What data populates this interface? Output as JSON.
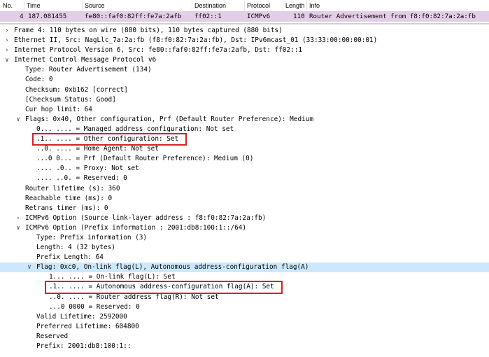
{
  "packet_list": {
    "columns": [
      "No.",
      "Time",
      "Source",
      "Destination",
      "Protocol",
      "Length",
      "Info"
    ],
    "selected_row": {
      "no": "4",
      "time": "187.081455",
      "source": "fe80::faf0:82ff:fe7a:2afb",
      "destination": "ff02::1",
      "protocol": "ICMPv6",
      "length": "110",
      "info": "Router Advertisement from f8:f0:82:7a:2a:fb"
    }
  },
  "details": [
    {
      "text": "Frame 4: 110 bytes on wire (880 bits), 110 bytes captured (880 bits)",
      "arrow": "collapsed",
      "indent": 0
    },
    {
      "text": "Ethernet II, Src: NagLlc_7a:2a:fb (f8:f0:82:7a:2a:fb), Dst: IPv6mcast_01 (33:33:00:00:00:01)",
      "arrow": "collapsed",
      "indent": 0
    },
    {
      "text": "Internet Protocol Version 6, Src: fe80::faf0:82ff:fe7a:2afb, Dst: ff02::1",
      "arrow": "collapsed",
      "indent": 0
    },
    {
      "text": "Internet Control Message Protocol v6",
      "arrow": "expanded",
      "indent": 0
    },
    {
      "text": "Type: Router Advertisement (134)",
      "arrow": "none",
      "indent": 1
    },
    {
      "text": "Code: 0",
      "arrow": "none",
      "indent": 1
    },
    {
      "text": "Checksum: 0xb162 [correct]",
      "arrow": "none",
      "indent": 1
    },
    {
      "text": "[Checksum Status: Good]",
      "arrow": "none",
      "indent": 1
    },
    {
      "text": "Cur hop limit: 64",
      "arrow": "none",
      "indent": 1
    },
    {
      "text": "Flags: 0x40, Other configuration, Prf (Default Router Preference): Medium",
      "arrow": "expanded",
      "indent": 1
    },
    {
      "text": "0... .... = Managed address configuration: Not set",
      "arrow": "none",
      "indent": 2
    },
    {
      "text": ".1.. .... = Other configuration: Set",
      "arrow": "none",
      "indent": 2
    },
    {
      "text": "..0. .... = Home Agent: Not set",
      "arrow": "none",
      "indent": 2
    },
    {
      "text": "...0 0... = Prf (Default Router Preference): Medium (0)",
      "arrow": "none",
      "indent": 2
    },
    {
      "text": ".... .0.. = Proxy: Not set",
      "arrow": "none",
      "indent": 2
    },
    {
      "text": ".... ..0. = Reserved: 0",
      "arrow": "none",
      "indent": 2
    },
    {
      "text": "Router lifetime (s): 360",
      "arrow": "none",
      "indent": 1
    },
    {
      "text": "Reachable time (ms): 0",
      "arrow": "none",
      "indent": 1
    },
    {
      "text": "Retrans timer (ms): 0",
      "arrow": "none",
      "indent": 1
    },
    {
      "text": "ICMPv6 Option (Source link-layer address : f8:f0:82:7a:2a:fb)",
      "arrow": "collapsed",
      "indent": 1
    },
    {
      "text": "ICMPv6 Option (Prefix information : 2001:db8:100:1::/64)",
      "arrow": "expanded",
      "indent": 1
    },
    {
      "text": "Type: Prefix information (3)",
      "arrow": "none",
      "indent": 2
    },
    {
      "text": "Length: 4 (32 bytes)",
      "arrow": "none",
      "indent": 2
    },
    {
      "text": "Prefix Length: 64",
      "arrow": "none",
      "indent": 2
    },
    {
      "text": "Flag: 0xc0, On-link flag(L), Autonomous address-configuration flag(A)",
      "arrow": "expanded",
      "indent": 2,
      "selected": true
    },
    {
      "text": "1... .... = On-link flag(L): Set",
      "arrow": "none",
      "indent": 3
    },
    {
      "text": ".1.. .... = Autonomous address-configuration flag(A): Set",
      "arrow": "none",
      "indent": 3
    },
    {
      "text": "..0. .... = Router address flag(R): Not set",
      "arrow": "none",
      "indent": 3
    },
    {
      "text": "...0 0000 = Reserved: 0",
      "arrow": "none",
      "indent": 3
    },
    {
      "text": "Valid Lifetime: 2592000",
      "arrow": "none",
      "indent": 2
    },
    {
      "text": "Preferred Lifetime: 604800",
      "arrow": "none",
      "indent": 2
    },
    {
      "text": "Reserved",
      "arrow": "none",
      "indent": 2
    },
    {
      "text": "Prefix: 2001:db8:100:1::",
      "arrow": "none",
      "indent": 2
    }
  ],
  "annotations": {
    "highlight_color": "#d42222",
    "highlighted_rows": [
      11,
      26
    ]
  }
}
